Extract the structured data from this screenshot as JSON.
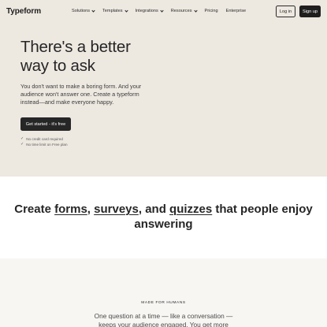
{
  "nav": {
    "logo": "Typeform",
    "links": [
      {
        "label": "Solutions",
        "dropdown": true
      },
      {
        "label": "Templates",
        "dropdown": true
      },
      {
        "label": "Integrations",
        "dropdown": true
      },
      {
        "label": "Resources",
        "dropdown": true
      },
      {
        "label": "Pricing",
        "dropdown": false
      },
      {
        "label": "Enterprise",
        "dropdown": false
      }
    ],
    "login_label": "Log in",
    "signup_label": "Sign up"
  },
  "hero": {
    "title": "There's a better way to ask",
    "subtitle": "You don't want to make a boring form. And your audience won't answer one. Create a typeform instead—and make everyone happy.",
    "cta_label": "Get started - it's free",
    "checks": [
      "No credit card required",
      "No time limit on Free plan"
    ]
  },
  "section2": {
    "pre": "Create ",
    "link1": "forms",
    "sep1": ", ",
    "link2": "surveys",
    "sep2": ", and ",
    "link3": "quizzes",
    "post": " that people enjoy answering"
  },
  "section3": {
    "eyebrow": "MADE FOR HUMANS",
    "body": "One question at a time — like a conversation — keeps your audience engaged. You get more"
  },
  "colors": {
    "hero_bg": "#ede8e0",
    "dark": "#262627",
    "section3_bg": "#f8f6f3"
  }
}
